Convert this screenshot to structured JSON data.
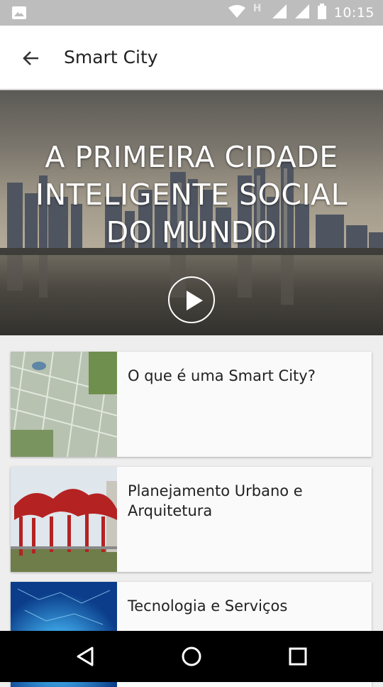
{
  "status_bar": {
    "time": "10:15",
    "icons": [
      "image-notification-icon",
      "wifi-icon",
      "h-network-icon",
      "signal-icon",
      "signal-icon",
      "battery-icon"
    ],
    "network_letter": "H"
  },
  "app_bar": {
    "title": "Smart City",
    "back_icon": "arrow-back-icon"
  },
  "hero": {
    "headline": "A PRIMEIRA CIDADE\nINTELIGENTE SOCIAL\nDO MUNDO",
    "play_icon": "play-icon"
  },
  "cards": [
    {
      "label": "O que é uma Smart City?",
      "image": "aerial-city-plan"
    },
    {
      "label": "Planejamento Urbano e Arquitetura",
      "image": "red-sculpture-pavilion"
    },
    {
      "label": "Tecnologia e Serviços",
      "image": "blue-technology-network"
    }
  ],
  "nav_bar": {
    "icons": [
      "back-triangle-icon",
      "home-circle-icon",
      "recents-square-icon"
    ]
  }
}
